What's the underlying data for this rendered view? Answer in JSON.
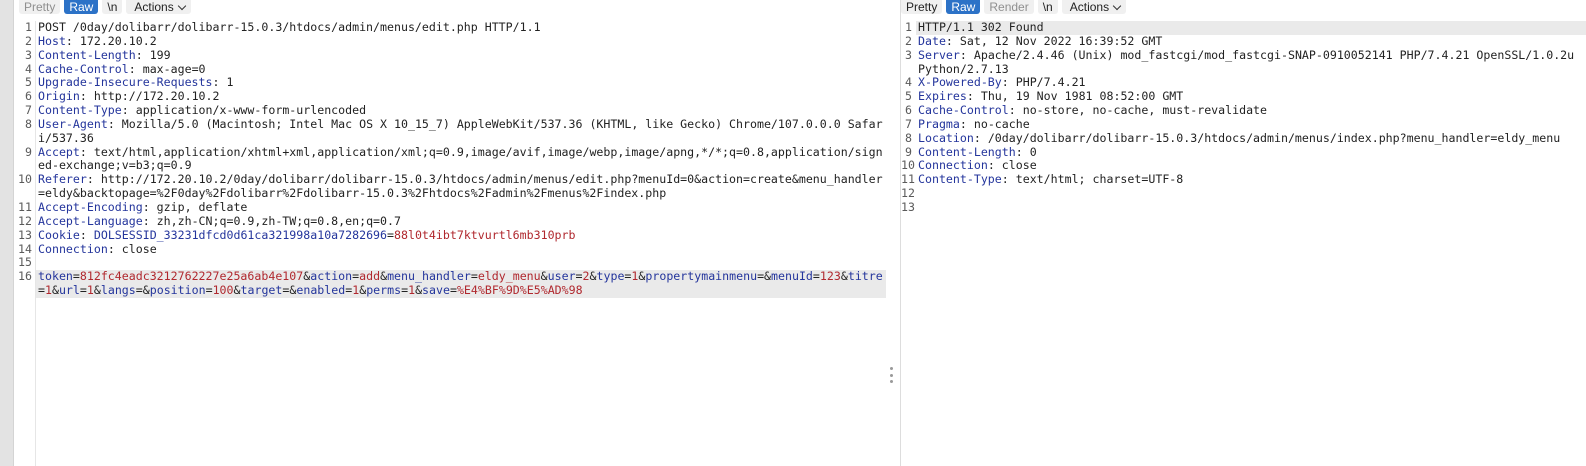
{
  "request": {
    "toolbar": {
      "pretty": "Pretty",
      "raw": "Raw",
      "newline": "\\n",
      "actions": "Actions"
    },
    "request_line": "POST /0day/dolibarr/dolibarr-15.0.3/htdocs/admin/menus/edit.php HTTP/1.1",
    "headers": [
      {
        "line": "2",
        "name": "Host",
        "value": "172.20.10.2"
      },
      {
        "line": "3",
        "name": "Content-Length",
        "value": "199"
      },
      {
        "line": "4",
        "name": "Cache-Control",
        "value": "max-age=0"
      },
      {
        "line": "5",
        "name": "Upgrade-Insecure-Requests",
        "value": "1"
      },
      {
        "line": "6",
        "name": "Origin",
        "value": "http://172.20.10.2"
      },
      {
        "line": "7",
        "name": "Content-Type",
        "value": "application/x-www-form-urlencoded"
      },
      {
        "line": "8",
        "name": "User-Agent",
        "value": "Mozilla/5.0 (Macintosh; Intel Mac OS X 10_15_7) AppleWebKit/537.36 (KHTML, like Gecko) Chrome/107.0.0.0 Safari/537.36"
      },
      {
        "line": "9",
        "name": "Accept",
        "value": "text/html,application/xhtml+xml,application/xml;q=0.9,image/avif,image/webp,image/apng,*/*;q=0.8,application/signed-exchange;v=b3;q=0.9"
      },
      {
        "line": "10",
        "name": "Referer",
        "value": "http://172.20.10.2/0day/dolibarr/dolibarr-15.0.3/htdocs/admin/menus/edit.php?menuId=0&action=create&menu_handler=eldy&backtopage=%2F0day%2Fdolibarr%2Fdolibarr-15.0.3%2Fhtdocs%2Fadmin%2Fmenus%2Findex.php"
      },
      {
        "line": "11",
        "name": "Accept-Encoding",
        "value": "gzip, deflate"
      },
      {
        "line": "12",
        "name": "Accept-Language",
        "value": "zh,zh-CN;q=0.9,zh-TW;q=0.8,en;q=0.7"
      }
    ],
    "cookie": {
      "name": "Cookie",
      "key": "DOLSESSID_33231dfcd0d61ca321998a10a7282696",
      "value": "88l0t4ibt7ktvurtl6mb310prb"
    },
    "connection": {
      "name": "Connection",
      "value": "close"
    },
    "body_params": [
      {
        "name": "token",
        "value": "812fc4eadc3212762227e25a6ab4e107"
      },
      {
        "name": "action",
        "value": "add"
      },
      {
        "name": "menu_handler",
        "value": "eldy_menu"
      },
      {
        "name": "user",
        "value": "2"
      },
      {
        "name": "type",
        "value": "1"
      },
      {
        "name": "propertymainmenu",
        "value": ""
      },
      {
        "name": "menuId",
        "value": "123"
      },
      {
        "name": "titre",
        "value": "1"
      },
      {
        "name": "url",
        "value": "1"
      },
      {
        "name": "langs",
        "value": ""
      },
      {
        "name": "position",
        "value": "100"
      },
      {
        "name": "target",
        "value": ""
      },
      {
        "name": "enabled",
        "value": "1"
      },
      {
        "name": "perms",
        "value": "1"
      },
      {
        "name": "save",
        "value": "%E4%BF%9D%E5%AD%98"
      }
    ]
  },
  "response": {
    "toolbar": {
      "pretty": "Pretty",
      "raw": "Raw",
      "render": "Render",
      "newline": "\\n",
      "actions": "Actions"
    },
    "status_line": "HTTP/1.1 302 Found",
    "headers": [
      {
        "line": "2",
        "name": "Date",
        "value": "Sat, 12 Nov 2022 16:39:52 GMT"
      },
      {
        "line": "3",
        "name": "Server",
        "value": "Apache/2.4.46 (Unix) mod_fastcgi/mod_fastcgi-SNAP-0910052141 PHP/7.4.21 OpenSSL/1.0.2u",
        "continuation": "Python/2.7.13"
      },
      {
        "line": "4",
        "name": "X-Powered-By",
        "value": "PHP/7.4.21"
      },
      {
        "line": "5",
        "name": "Expires",
        "value": "Thu, 19 Nov 1981 08:52:00 GMT"
      },
      {
        "line": "6",
        "name": "Cache-Control",
        "value": "no-store, no-cache, must-revalidate"
      },
      {
        "line": "7",
        "name": "Pragma",
        "value": "no-cache"
      },
      {
        "line": "8",
        "name": "Location",
        "value": "/0day/dolibarr/dolibarr-15.0.3/htdocs/admin/menus/index.php?menu_handler=eldy_menu"
      },
      {
        "line": "9",
        "name": "Content-Length",
        "value": "0"
      },
      {
        "line": "10",
        "name": "Connection",
        "value": "close"
      },
      {
        "line": "11",
        "name": "Content-Type",
        "value": "text/html; charset=UTF-8"
      }
    ]
  },
  "colors": {
    "header_key": "#24359c",
    "param_value": "#b0282e",
    "active_tab": "#2c72c7"
  },
  "icons": {
    "actions": "chevron-down-icon",
    "splitter": "kebab-vertical-icon"
  }
}
